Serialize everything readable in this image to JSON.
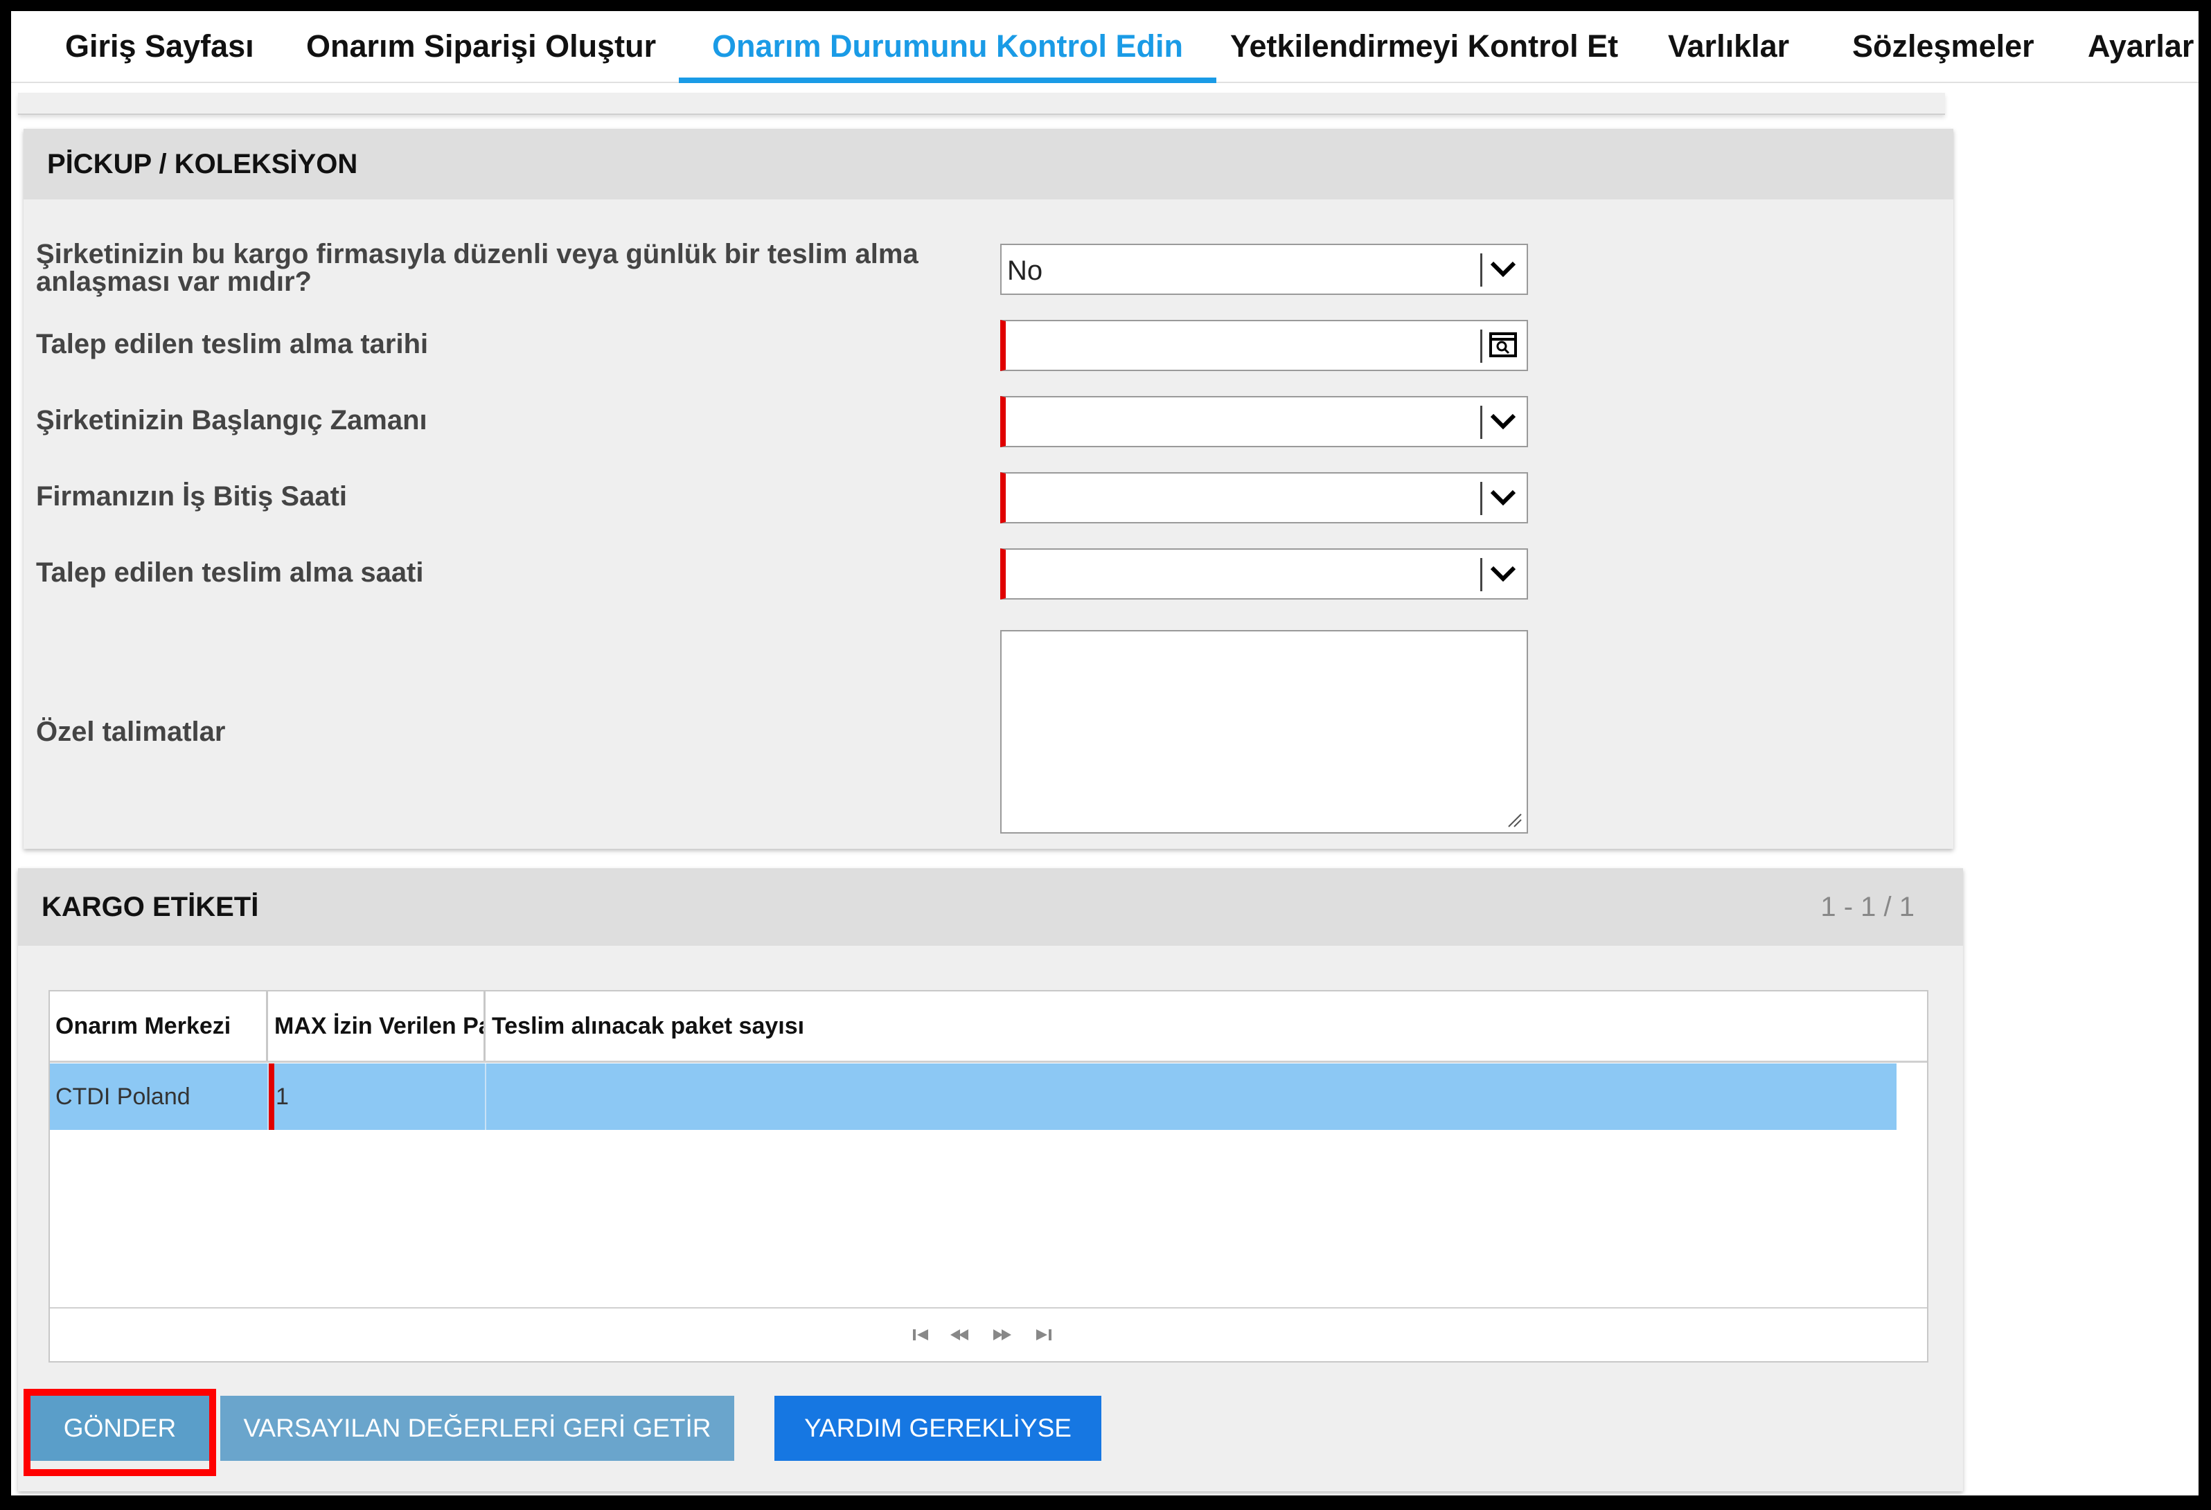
{
  "nav": {
    "tabs": [
      {
        "label": "Giriş Sayfası"
      },
      {
        "label": "Onarım Siparişi Oluştur"
      },
      {
        "label": "Onarım Durumunu Kontrol Edin"
      },
      {
        "label": "Yetkilendirmeyi Kontrol Et"
      },
      {
        "label": "Varlıklar"
      },
      {
        "label": "Sözleşmeler"
      },
      {
        "label": "Ayarlar"
      }
    ],
    "active_tab": "Onarım Durumunu Kontrol Edin",
    "active_color": "#1a9be6"
  },
  "pickup": {
    "title": "PİCKUP / KOLEKSİYON",
    "fields": [
      {
        "label_line1": "Şirketinizin bu kargo firmasıyla düzenli veya günlük bir teslim alma",
        "label_line2": "anlaşması var mıdır?",
        "value": "No",
        "control": "select",
        "icon": "chevron-down-icon"
      },
      {
        "label": "Talep edilen teslim alma tarihi",
        "value": "",
        "control": "date",
        "icon": "calendar-search-icon",
        "required": true
      },
      {
        "label": "Şirketinizin Başlangıç Zamanı",
        "value": "",
        "control": "select",
        "icon": "chevron-down-icon",
        "required": true
      },
      {
        "label": "Firmanızın İş Bitiş Saati",
        "value": "",
        "control": "select",
        "icon": "chevron-down-icon",
        "required": true
      },
      {
        "label": "Talep edilen teslim alma saati",
        "value": "",
        "control": "select",
        "icon": "chevron-down-icon",
        "required": true
      },
      {
        "label": "Özel talimatlar",
        "value": "",
        "control": "textarea"
      }
    ]
  },
  "kargo": {
    "title": "KARGO ETİKETİ",
    "pager_text": "1 - 1 / 1",
    "columns": [
      "Onarım Merkezi",
      "MAX İzin Verilen Pa",
      "Teslim alınacak paket sayısı"
    ],
    "rows": [
      {
        "center": "CTDI Poland",
        "max": "1",
        "count": ""
      }
    ],
    "selected_row_color": "#8cc8f4",
    "pager_icons": [
      "first-page-icon",
      "previous-page-icon",
      "next-page-icon",
      "last-page-icon"
    ]
  },
  "actions": {
    "send": "GÖNDER",
    "restore": "VARSAYILAN DEĞERLERİ GERİ GETİR",
    "help": "YARDIM GEREKLİYSE"
  },
  "colors": {
    "send_btn": "#5a9ec9",
    "restore_btn": "#6aa5cc",
    "help_btn": "#1677e2",
    "highlight": "#ff0000",
    "required": "#e00000"
  }
}
